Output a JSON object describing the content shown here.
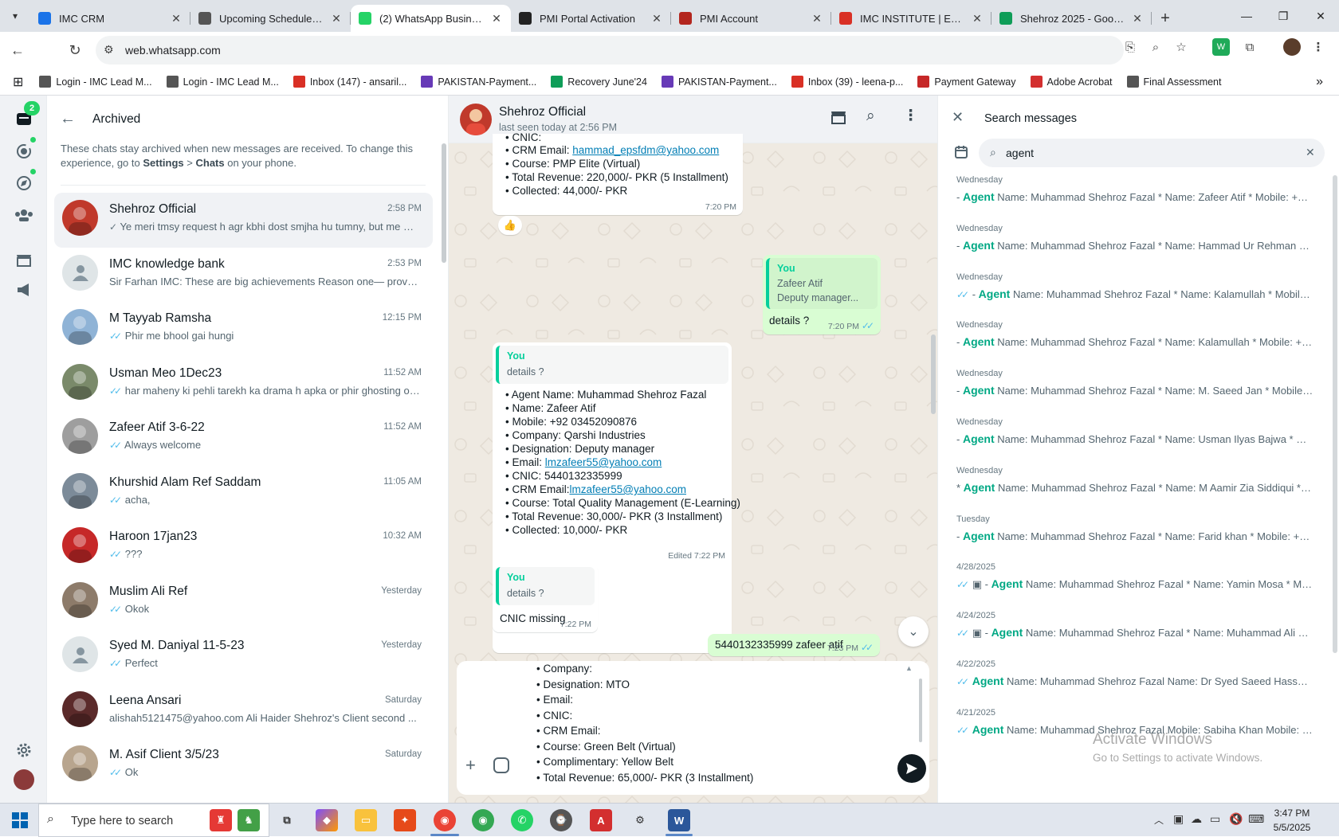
{
  "browser": {
    "tabs": [
      {
        "label": "IMC CRM",
        "favicon_color": "#1a73e8",
        "active": false
      },
      {
        "label": "Upcoming Schedules | IMC",
        "favicon_color": "#555555",
        "active": false
      },
      {
        "label": "(2) WhatsApp Business",
        "favicon_color": "#25d366",
        "active": true
      },
      {
        "label": "PMI Portal Activation",
        "favicon_color": "#222222",
        "active": false
      },
      {
        "label": "PMI Account",
        "favicon_color": "#b3261e",
        "active": false
      },
      {
        "label": "IMC INSTITUTE | ENROLL",
        "favicon_color": "#d93025",
        "active": false
      },
      {
        "label": "Shehroz 2025 - Google Sheets",
        "favicon_color": "#0f9d58",
        "active": false
      }
    ],
    "url": "web.whatsapp.com",
    "bookmarks": [
      {
        "label": "Login - IMC Lead M...",
        "color": "#555555"
      },
      {
        "label": "Login - IMC Lead M...",
        "color": "#555555"
      },
      {
        "label": "Inbox (147) - ansaril...",
        "color": "#d93025"
      },
      {
        "label": "PAKISTAN-Payment...",
        "color": "#673ab7"
      },
      {
        "label": "Recovery June'24",
        "color": "#0f9d58"
      },
      {
        "label": "PAKISTAN-Payment...",
        "color": "#673ab7"
      },
      {
        "label": "Inbox (39) - leena-p...",
        "color": "#d93025"
      },
      {
        "label": "Payment Gateway",
        "color": "#c62828"
      },
      {
        "label": "Adobe Acrobat",
        "color": "#d32f2f"
      },
      {
        "label": "Final Assessment",
        "color": "#555555"
      }
    ]
  },
  "rail": {
    "unread_badge": "2"
  },
  "archived": {
    "title": "Archived",
    "note_prefix": "These chats stay archived when new messages are received. To change this experience, go to ",
    "note_settings": "Settings",
    "note_sep": " > ",
    "note_chats": "Chats",
    "note_suffix": " on your phone.",
    "chats": [
      {
        "name": "Shehroz Official",
        "time": "2:58 PM",
        "preview": "Ye meri tmsy request h agr kbhi dost smjha hu tumny, but me m...",
        "tick": "✓",
        "avatar_color": "#c0392b",
        "selected": true
      },
      {
        "name": "IMC knowledge bank",
        "time": "2:53 PM",
        "preview": "Sir Farhan IMC: These are big achievements  Reason one— proves ...",
        "tick": "",
        "avatar_color": "#dfe5e7",
        "selected": false
      },
      {
        "name": "M Tayyab Ramsha",
        "time": "12:15 PM",
        "preview": "Phir me bhool gai hungi",
        "tick": "✓✓",
        "avatar_color": "#8fb3d6",
        "selected": false
      },
      {
        "name": "Usman Meo 1Dec23",
        "time": "11:52 AM",
        "preview": "har maheny ki pehli tarekh ka drama h apka or phir ghosting or j...",
        "tick": "✓✓",
        "avatar_color": "#7a8a6a",
        "selected": false
      },
      {
        "name": "Zafeer Atif 3-6-22",
        "time": "11:52 AM",
        "preview": "Always welcome",
        "tick": "✓✓",
        "avatar_color": "#9e9e9e",
        "selected": false
      },
      {
        "name": "Khurshid Alam Ref Saddam",
        "time": "11:05 AM",
        "preview": "acha,",
        "tick": "✓✓",
        "avatar_color": "#7c8b99",
        "selected": false
      },
      {
        "name": "Haroon 17jan23",
        "time": "10:32 AM",
        "preview": "???",
        "tick": "✓✓",
        "avatar_color": "#c62828",
        "selected": false
      },
      {
        "name": "Muslim Ali Ref",
        "time": "Yesterday",
        "preview": "Okok",
        "tick": "✓✓",
        "avatar_color": "#8d7b6a",
        "selected": false
      },
      {
        "name": "Syed M. Daniyal 11-5-23",
        "time": "Yesterday",
        "preview": "Perfect",
        "tick": "✓✓",
        "avatar_color": "#dfe5e7",
        "selected": false
      },
      {
        "name": "Leena Ansari",
        "time": "Saturday",
        "preview": "alishah5121475@yahoo.com Ali Haider Shehroz's Client second ...",
        "tick": "",
        "avatar_color": "#5b2a2a",
        "selected": false
      },
      {
        "name": "M. Asif Client 3/5/23",
        "time": "Saturday",
        "preview": "Ok",
        "tick": "✓✓",
        "avatar_color": "#b8a58e",
        "selected": false
      }
    ]
  },
  "conversation": {
    "contact_name": "Shehroz Official",
    "last_seen": "last seen today at 2:56 PM",
    "msg1": {
      "lines": [
        "• CNIC:",
        "• CRM Email: ",
        "• Course: PMP Elite (Virtual)",
        "• Total Revenue: 220,000/- PKR (5 Installment)",
        "• Collected:  44,000/- PKR"
      ],
      "email": "hammad_epsfdm@yahoo.com",
      "time": "7:20 PM",
      "reaction": "👍"
    },
    "msg2": {
      "quote_author": "You",
      "quote_line1": "Zafeer Atif",
      "quote_line2": "Deputy manager...",
      "text": "details ?",
      "time": "7:20 PM"
    },
    "msg3": {
      "quote_author": "You",
      "quote_line1": "details ?",
      "lines": [
        "• Agent Name: Muhammad Shehroz Fazal",
        "• Name: Zafeer Atif",
        "• Mobile: +92 03452090876",
        "• Company: Qarshi Industries",
        "• Designation: Deputy manager",
        "• Email: ",
        "• CNIC: 5440132335999",
        "• CRM Email:",
        "• Course: Total Quality Management (E-Learning)",
        "• Total Revenue: 30,000/- PKR (3 Installment)",
        "• Collected:  10,000/- PKR"
      ],
      "email": "lmzafeer55@yahoo.com",
      "crm_email": "lmzafeer55@yahoo.com",
      "time": "Edited 7:22 PM"
    },
    "msg4": {
      "quote_author": "You",
      "quote_line1": "details ?",
      "text": "CNIC missing",
      "time": "7:22 PM"
    },
    "msg5": {
      "text": "5440132335999 zafeer atif",
      "time": "7:23 PM"
    },
    "draft_lines": [
      "• Company:",
      "• Designation: MTO",
      "• Email:",
      "• CNIC:",
      "• CRM Email:",
      "• Course: Green Belt (Virtual)",
      "• Complimentary: Yellow Belt",
      "• Total Revenue: 65,000/- PKR (3 Installment)"
    ]
  },
  "search": {
    "title": "Search messages",
    "query": "agent",
    "results": [
      {
        "date": "Wednesday",
        "prefix": "- ",
        "tick": "",
        "keyword": "Agent",
        "rest": " Name: Muhammad Shehroz Fazal * Name: Zafeer Atif * Mobile: +92 0..."
      },
      {
        "date": "Wednesday",
        "prefix": "- ",
        "tick": "",
        "keyword": "Agent",
        "rest": " Name: Muhammad Shehroz Fazal * Name: Hammad Ur Rehman Goha..."
      },
      {
        "date": "Wednesday",
        "prefix": " - ",
        "tick": "✓✓",
        "keyword": "Agent",
        "rest": " Name: Muhammad Shehroz Fazal * Name: Kalamullah  * Mobile: +..."
      },
      {
        "date": "Wednesday",
        "prefix": "- ",
        "tick": "",
        "keyword": "Agent",
        "rest": " Name: Muhammad Shehroz Fazal * Name: Kalamullah  * Mobile: +92 ..."
      },
      {
        "date": "Wednesday",
        "prefix": "- ",
        "tick": "",
        "keyword": "Agent",
        "rest": " Name: Muhammad Shehroz Fazal * Name: M. Saeed Jan  * Mobile: +9..."
      },
      {
        "date": "Wednesday",
        "prefix": "- ",
        "tick": "",
        "keyword": "Agent",
        "rest": " Name: Muhammad Shehroz Fazal * Name: Usman Ilyas Bajwa * Mobile..."
      },
      {
        "date": "Wednesday",
        "prefix": "* ",
        "tick": "",
        "keyword": "Agent",
        "rest": " Name: Muhammad Shehroz Fazal * Name: M Aamir Zia Siddiqui * Mo..."
      },
      {
        "date": "Tuesday",
        "prefix": "- ",
        "tick": "",
        "keyword": "Agent",
        "rest": " Name: Muhammad Shehroz Fazal * Name: Farid khan * Mobile: +9234..."
      },
      {
        "date": "4/28/2025",
        "prefix": " ▣ - ",
        "tick": "✓✓",
        "keyword": "Agent",
        "rest": " Name: Muhammad Shehroz Fazal * Name: Yamin Mosa * Mobil..."
      },
      {
        "date": "4/24/2025",
        "prefix": " ▣ - ",
        "tick": "✓✓",
        "keyword": "Agent",
        "rest": " Name: Muhammad Shehroz Fazal * Name: Muhammad Ali Qazi..."
      },
      {
        "date": "4/22/2025",
        "prefix": " ",
        "tick": "✓✓",
        "keyword": "Agent",
        "rest": " Name: Muhammad Shehroz Fazal Name: Dr Syed Saeed Hassan Chis..."
      },
      {
        "date": "4/21/2025",
        "prefix": " ",
        "tick": "✓✓",
        "keyword": "Agent",
        "rest": " Name: Muhammad Shehroz Fazal Mobile: Sabiha Khan Mobile: +923..."
      }
    ]
  },
  "watermark": {
    "line1": "Activate Windows",
    "line2": "Go to Settings to activate Windows."
  },
  "taskbar": {
    "search_placeholder": "Type here to search",
    "time": "3:47 PM",
    "date": "5/5/2025"
  }
}
